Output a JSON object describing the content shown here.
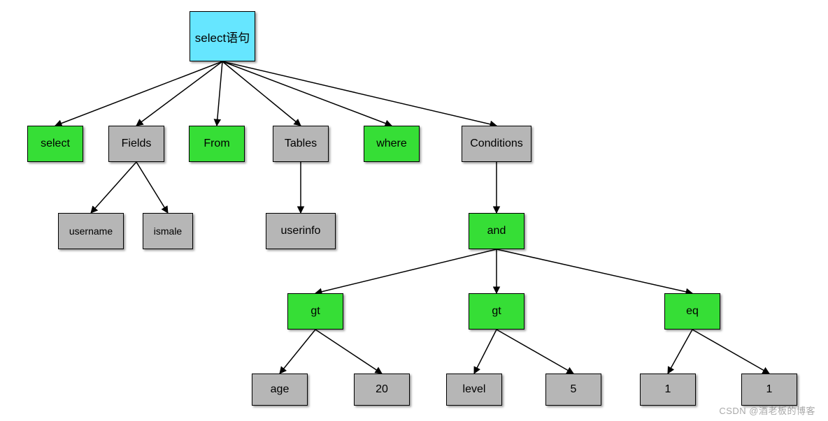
{
  "colors": {
    "cyan": "#66e6ff",
    "green": "#36de36",
    "gray": "#b6b6b6"
  },
  "nodes": {
    "root": {
      "label": "select语句",
      "color": "cyan"
    },
    "select": {
      "label": "select",
      "color": "green"
    },
    "fields": {
      "label": "Fields",
      "color": "gray"
    },
    "from": {
      "label": "From",
      "color": "green"
    },
    "tables": {
      "label": "Tables",
      "color": "gray"
    },
    "where": {
      "label": "where",
      "color": "green"
    },
    "conditions": {
      "label": "Conditions",
      "color": "gray"
    },
    "username": {
      "label": "username",
      "color": "gray"
    },
    "ismale": {
      "label": "ismale",
      "color": "gray"
    },
    "userinfo": {
      "label": "userinfo",
      "color": "gray"
    },
    "and": {
      "label": "and",
      "color": "green"
    },
    "gt1": {
      "label": "gt",
      "color": "green"
    },
    "gt2": {
      "label": "gt",
      "color": "green"
    },
    "eq": {
      "label": "eq",
      "color": "green"
    },
    "age": {
      "label": "age",
      "color": "gray"
    },
    "v20": {
      "label": "20",
      "color": "gray"
    },
    "level": {
      "label": "level",
      "color": "gray"
    },
    "v5": {
      "label": "5",
      "color": "gray"
    },
    "one_a": {
      "label": "1",
      "color": "gray"
    },
    "one_b": {
      "label": "1",
      "color": "gray"
    }
  },
  "edges": [
    [
      "root",
      "select"
    ],
    [
      "root",
      "fields"
    ],
    [
      "root",
      "from"
    ],
    [
      "root",
      "tables"
    ],
    [
      "root",
      "where"
    ],
    [
      "root",
      "conditions"
    ],
    [
      "fields",
      "username"
    ],
    [
      "fields",
      "ismale"
    ],
    [
      "tables",
      "userinfo"
    ],
    [
      "conditions",
      "and"
    ],
    [
      "and",
      "gt1"
    ],
    [
      "and",
      "gt2"
    ],
    [
      "and",
      "eq"
    ],
    [
      "gt1",
      "age"
    ],
    [
      "gt1",
      "v20"
    ],
    [
      "gt2",
      "level"
    ],
    [
      "gt2",
      "v5"
    ],
    [
      "eq",
      "one_a"
    ],
    [
      "eq",
      "one_b"
    ]
  ],
  "watermark": "CSDN @酒老板的博客"
}
